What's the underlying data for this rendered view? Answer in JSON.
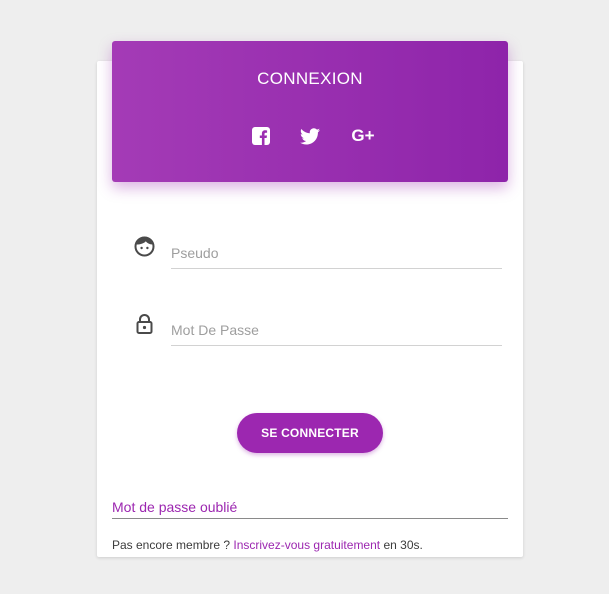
{
  "header": {
    "title": "CONNEXION",
    "social_icons": [
      "facebook-icon",
      "twitter-icon",
      "google-plus-icon"
    ],
    "google_plus_label": "G+"
  },
  "form": {
    "pseudo_placeholder": "Pseudo",
    "password_placeholder": "Mot De Passe",
    "submit_label": "SE CONNECTER",
    "icons": [
      "user-face-icon",
      "lock-icon"
    ]
  },
  "footer": {
    "forgot_label": "Mot de passe oublié",
    "signup_prefix": "Pas encore membre ? ",
    "signup_link": "Inscrivez-vous gratuitement",
    "signup_suffix": " en 30s."
  },
  "colors": {
    "accent": "#9c27b0",
    "header_gradient_start": "#a43bb6",
    "header_gradient_end": "#8e24aa",
    "background": "#eeeeee",
    "card": "#ffffff"
  }
}
